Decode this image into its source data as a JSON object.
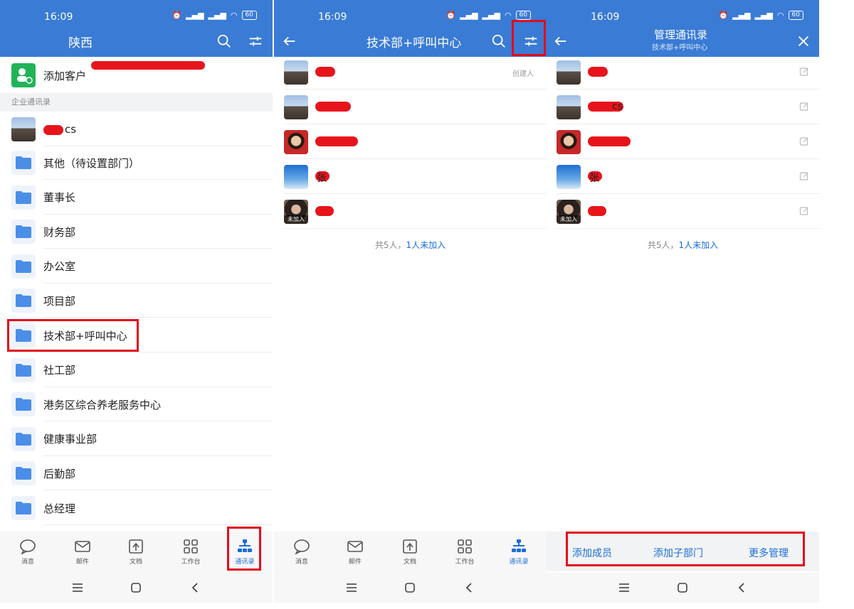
{
  "status": {
    "time": "16:09",
    "battery": "60"
  },
  "panel1": {
    "title": "陕西",
    "add_customer": "添加客户",
    "section_label": "企业通讯录",
    "top_member_suffix": "cs",
    "departments": [
      "其他（待设置部门）",
      "董事长",
      "财务部",
      "办公室",
      "项目部",
      "技术部+呼叫中心",
      "社工部",
      "港务区综合养老服务中心",
      "健康事业部",
      "后勤部",
      "总经理"
    ],
    "tabs": [
      "消息",
      "邮件",
      "文档",
      "工作台",
      "通讯录"
    ]
  },
  "panel2": {
    "title": "技术部+呼叫中心",
    "creator_tag": "创建人",
    "members": [
      {
        "avatar": "tower-avatar",
        "visible_text": "",
        "unjoined": false
      },
      {
        "avatar": "tower-avatar",
        "visible_text": "",
        "unjoined": false
      },
      {
        "avatar": "girl-avatar",
        "visible_text": "",
        "unjoined": false
      },
      {
        "avatar": "sky-avatar",
        "visible_text": "张",
        "unjoined": false
      },
      {
        "avatar": "dark-avatar",
        "visible_text": "",
        "unjoined": true
      }
    ],
    "unjoined_label": "未加入",
    "summary_prefix": "共5人，",
    "summary_link": "1人未加入",
    "tabs": [
      "消息",
      "邮件",
      "文档",
      "工作台",
      "通讯录"
    ]
  },
  "panel3": {
    "title": "管理通讯录",
    "subtitle": "技术部+呼叫中心",
    "member_suffix": "cs",
    "unjoined_label": "未加入",
    "summary_prefix": "共5人，",
    "summary_link": "1人未加入",
    "actions": [
      "添加成员",
      "添加子部门",
      "更多管理"
    ]
  },
  "colors": {
    "header_blue": "#3a7bd5",
    "accent_blue": "#1a6dd8",
    "highlight_red": "#e20a1a",
    "add_customer_green": "#21b35a"
  }
}
